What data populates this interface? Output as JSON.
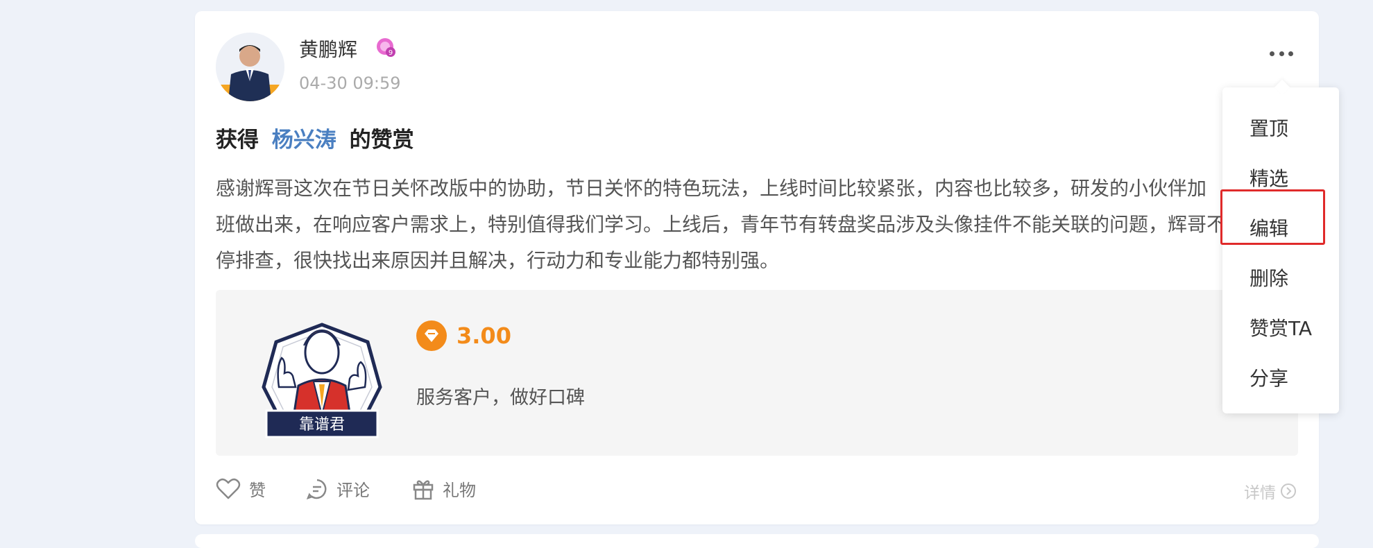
{
  "post": {
    "author": "黄鹏辉",
    "time": "04-30 09:59",
    "title_prefix": "获得",
    "title_user": "杨兴涛",
    "title_suffix": "的赞赏",
    "content_lines": [
      "感谢辉哥这次在节日关怀改版中的协助，节日关怀的特色玩法，上线时间比较紧张，内容也比较多，研发的小伙伴加",
      "班做出来，在响应客户需求上，特别值得我们学习。上线后，青年节有转盘奖品涉及头像挂件不能关联的问题，辉哥不",
      "停排查，很快找出来原因并且解决，行动力和专业能力都特别强。"
    ]
  },
  "reward": {
    "badge_label": "靠谱君",
    "amount": "3.00",
    "reason": "服务客户，做好口碑",
    "amount_color": "#f38b1a"
  },
  "actions": {
    "like": "赞",
    "comment": "评论",
    "gift": "礼物",
    "detail": "详情"
  },
  "menu": {
    "items": [
      "置顶",
      "精选",
      "编辑",
      "删除",
      "赞赏TA",
      "分享"
    ],
    "highlighted": "编辑"
  },
  "icons": {
    "more": "more-dots-icon",
    "like": "heart-icon",
    "comment": "comment-icon",
    "gift": "gift-icon",
    "detail": "chevron-right-circle-icon",
    "amount": "diamond-icon",
    "level": "level-badge-icon"
  },
  "colors": {
    "link": "#4a7fc1",
    "highlight_border": "#e02a2a",
    "background": "#eef2f9"
  }
}
